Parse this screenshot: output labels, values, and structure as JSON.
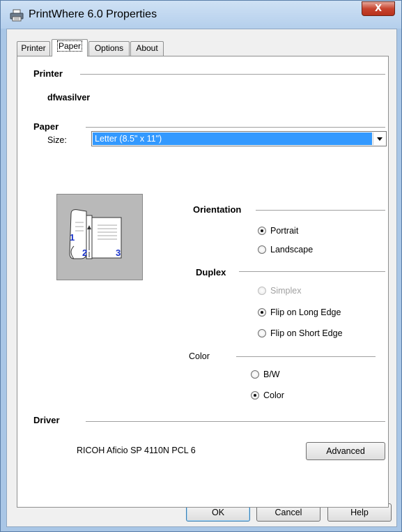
{
  "window": {
    "title": "PrintWhere 6.0 Properties",
    "close_label": "X",
    "title_icon": "printer-icon"
  },
  "tabs": [
    {
      "label": "Printer",
      "active": false
    },
    {
      "label": "Paper",
      "active": true
    },
    {
      "label": "Options",
      "active": false
    },
    {
      "label": "About",
      "active": false
    }
  ],
  "printer_section": {
    "title": "Printer",
    "name": "dfwasilver"
  },
  "paper_section": {
    "title": "Paper",
    "size_label": "Size:",
    "size_value": "Letter (8.5\" x 11\")"
  },
  "preview_icon": "duplex-booklet-icon",
  "preview_numbers": [
    "1",
    "2",
    "3"
  ],
  "orientation": {
    "title": "Orientation",
    "options": [
      {
        "label": "Portrait",
        "checked": true,
        "enabled": true
      },
      {
        "label": "Landscape",
        "checked": false,
        "enabled": true
      }
    ]
  },
  "duplex": {
    "title": "Duplex",
    "options": [
      {
        "label": "Simplex",
        "checked": false,
        "enabled": false
      },
      {
        "label": "Flip on Long Edge",
        "checked": true,
        "enabled": true
      },
      {
        "label": "Flip on Short Edge",
        "checked": false,
        "enabled": true
      }
    ]
  },
  "color": {
    "title": "Color",
    "options": [
      {
        "label": "B/W",
        "checked": false,
        "enabled": true
      },
      {
        "label": "Color",
        "checked": true,
        "enabled": true
      }
    ]
  },
  "driver": {
    "title": "Driver",
    "name": "RICOH Aficio SP 4110N PCL 6",
    "advanced_label": "Advanced"
  },
  "buttons": {
    "ok": "OK",
    "cancel": "Cancel",
    "help": "Help"
  },
  "colors": {
    "selection": "#3399ff",
    "preview_background": "#b9b9b9",
    "number_color": "#1a33c8"
  }
}
